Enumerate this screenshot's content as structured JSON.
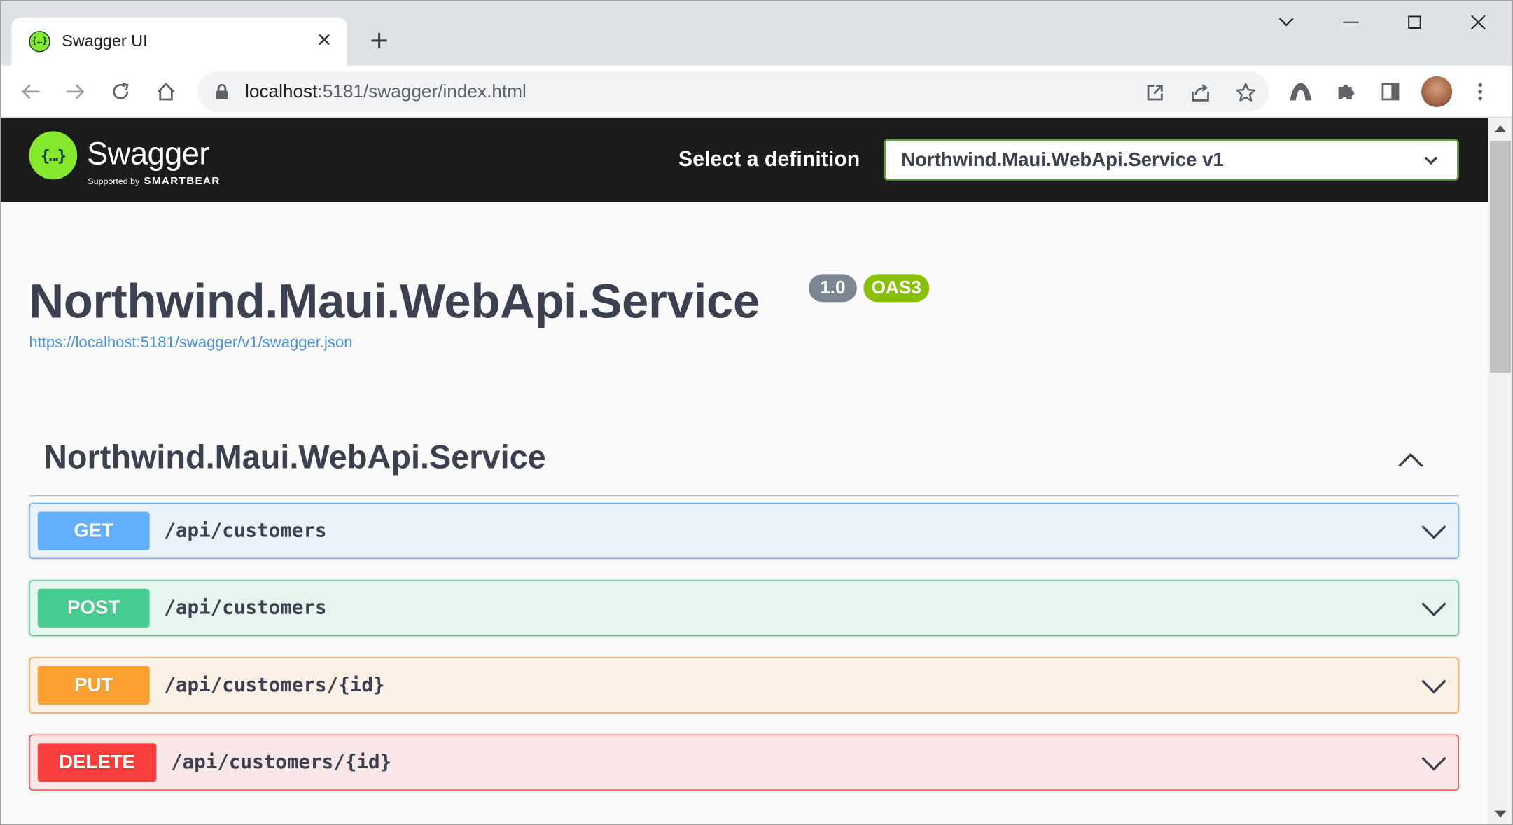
{
  "browser": {
    "tab_title": "Swagger UI",
    "url_host": "localhost",
    "url_rest": ":5181/swagger/index.html"
  },
  "swagger": {
    "brand": "Swagger",
    "supported_by": "Supported by",
    "smartbear": "SMARTBEAR",
    "select_label": "Select a definition",
    "selected_definition": "Northwind.Maui.WebApi.Service v1",
    "colors": {
      "topbar": "#1b1b1b",
      "logo": "#85ea2d",
      "select_border": "#62a03f"
    }
  },
  "info": {
    "title": "Northwind.Maui.WebApi.Service",
    "version": "1.0",
    "oas": "OAS3",
    "spec_url": "https://localhost:5181/swagger/v1/swagger.json"
  },
  "tag": {
    "name": "Northwind.Maui.WebApi.Service",
    "expanded": true
  },
  "operations": [
    {
      "method": "GET",
      "path": "/api/customers",
      "color": "#61affe"
    },
    {
      "method": "POST",
      "path": "/api/customers",
      "color": "#49cc90"
    },
    {
      "method": "PUT",
      "path": "/api/customers/{id}",
      "color": "#fca130"
    },
    {
      "method": "DELETE",
      "path": "/api/customers/{id}",
      "color": "#f93e3e"
    }
  ]
}
